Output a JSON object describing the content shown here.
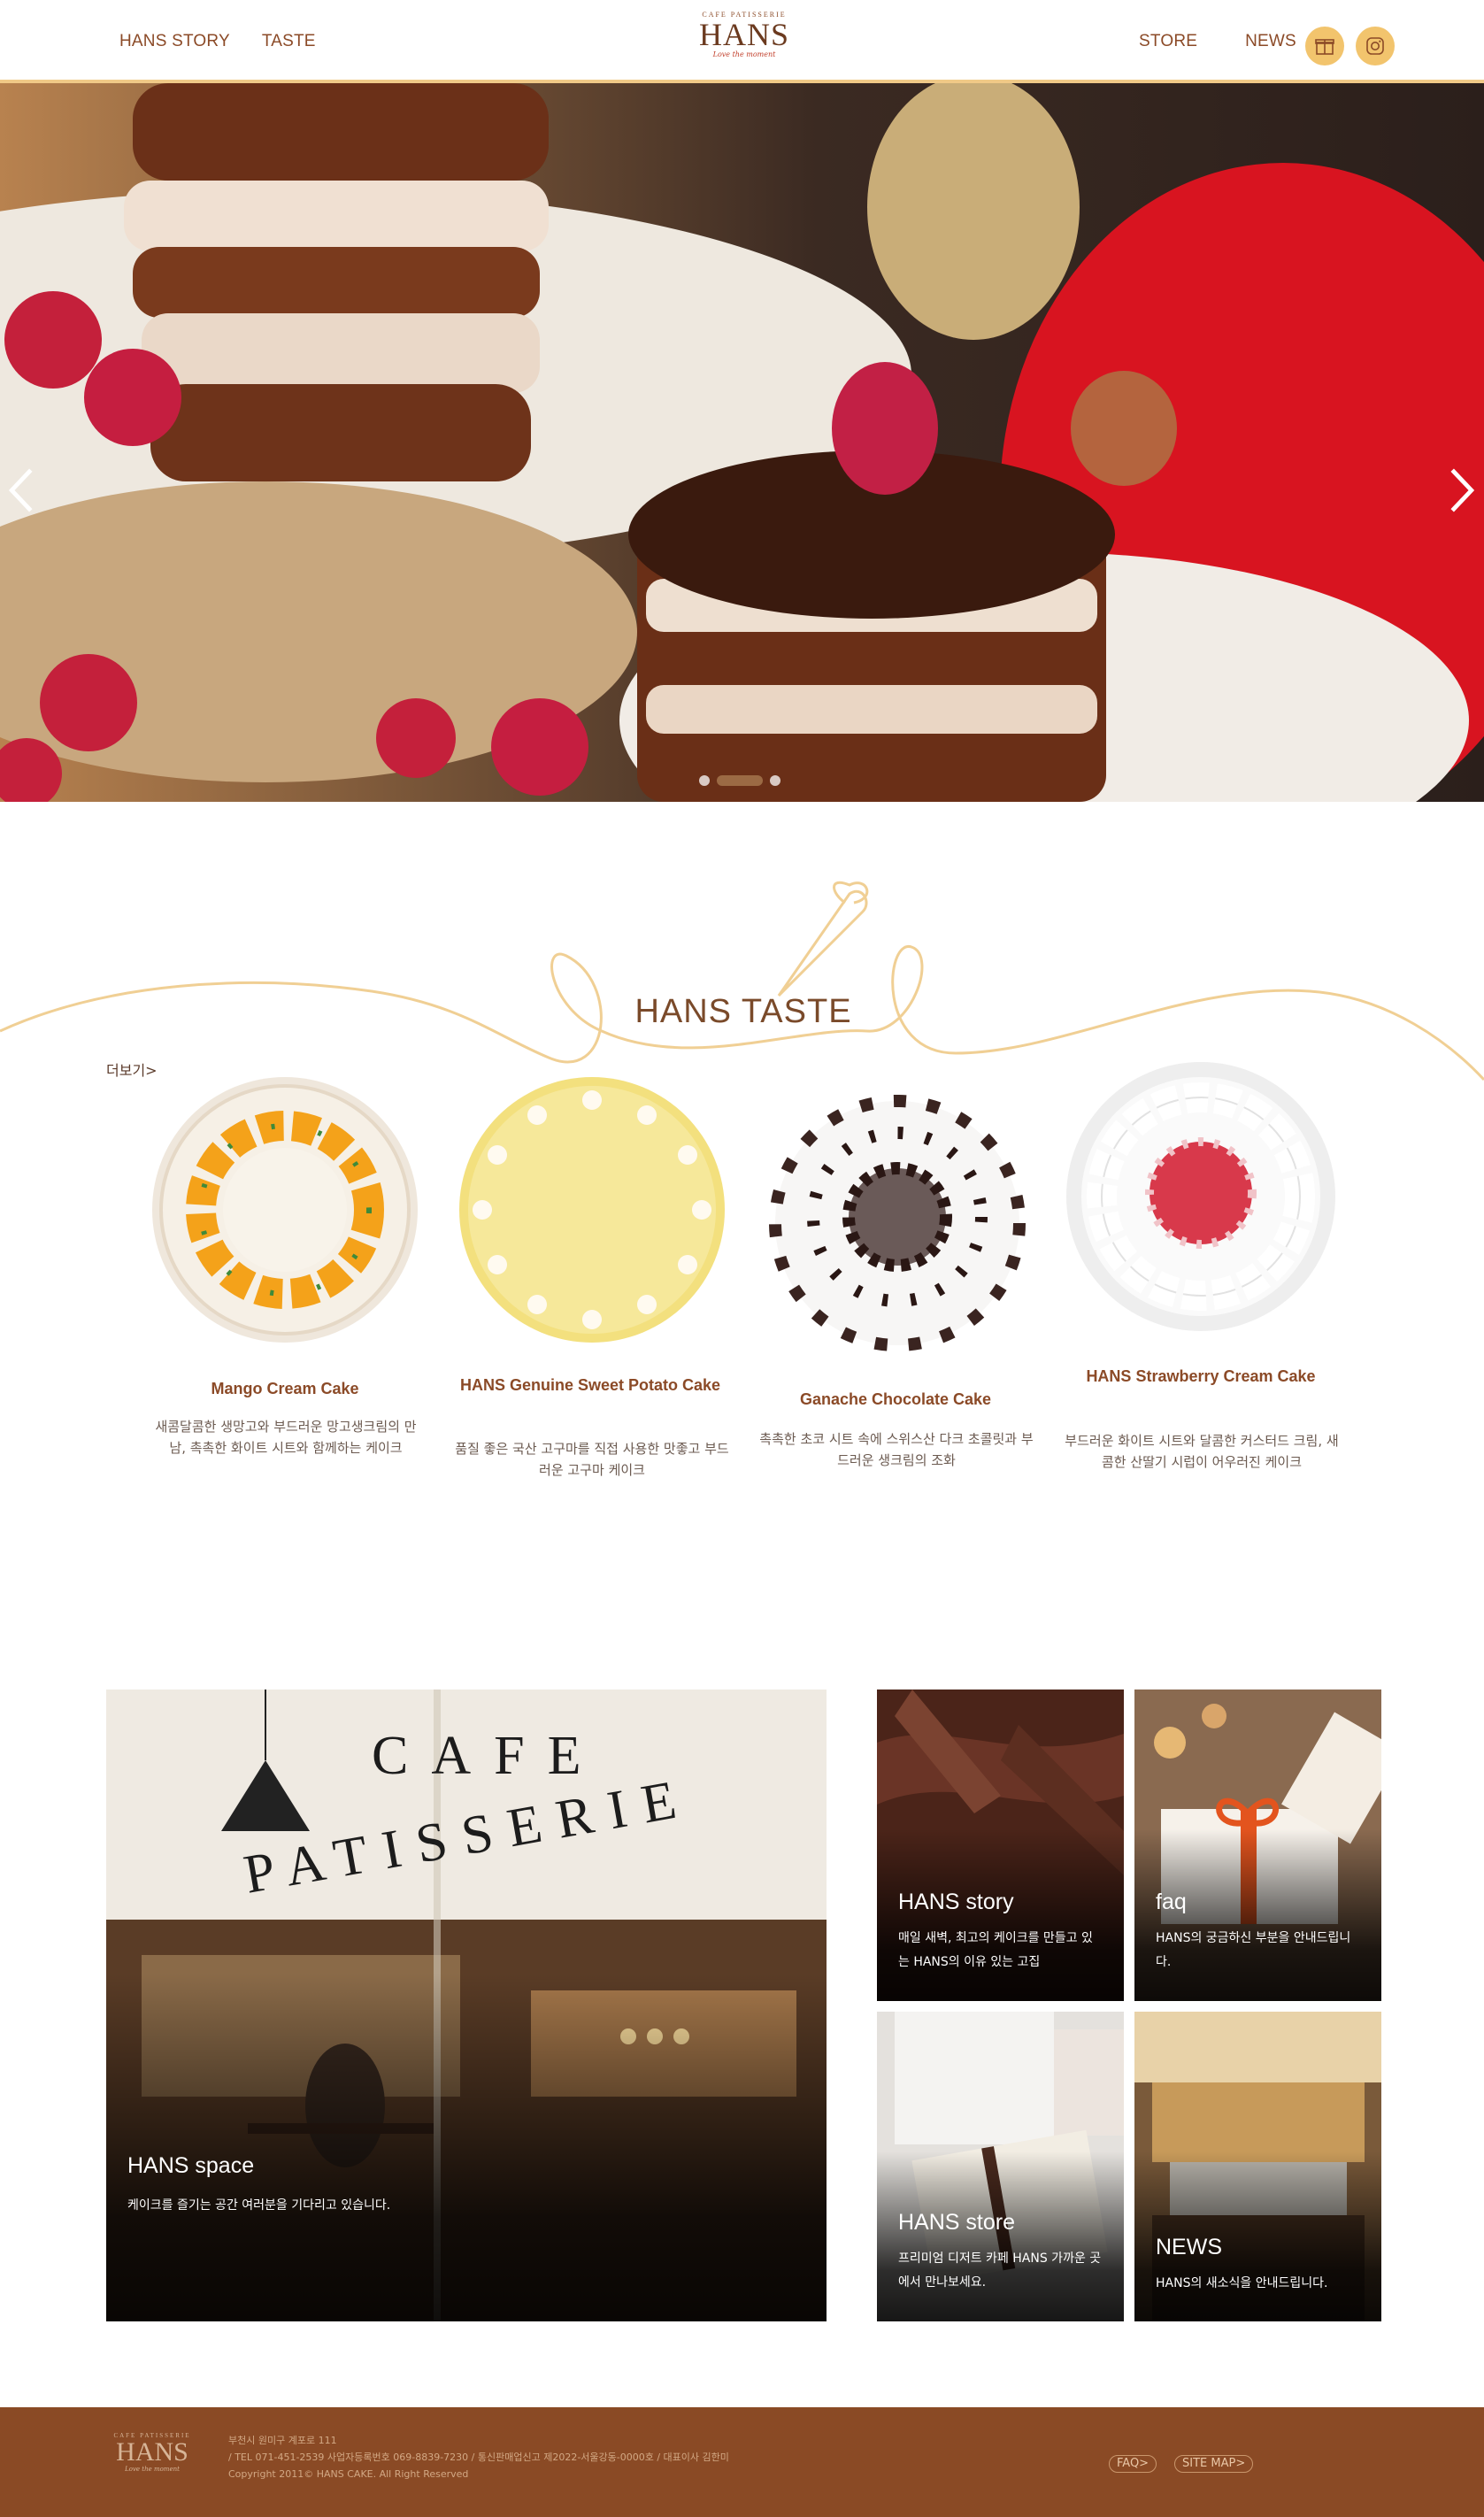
{
  "header": {
    "nav_left": [
      "HANS STORY",
      "TASTE"
    ],
    "nav_right": [
      "STORE",
      "NEWS"
    ],
    "logo": {
      "cafe": "CAFE PATISSERIE",
      "name": "HANS",
      "tagline": "Love the moment"
    },
    "icons": [
      "gift-icon",
      "instagram-icon"
    ]
  },
  "hero": {
    "prev_icon": "chevron-left-icon",
    "next_icon": "chevron-right-icon",
    "slides_count": 3,
    "active_slide": 2
  },
  "taste": {
    "title": "HANS TASTE",
    "more": "더보기>",
    "items": [
      {
        "name": "Mango Cream Cake",
        "desc": "새콤달콤한 생망고와 부드러운 망고생크림의 만남, 촉촉한 화이트 시트와 함께하는 케이크"
      },
      {
        "name": "HANS Genuine Sweet Potato Cake",
        "desc": "품질 좋은 국산 고구마를 직접 사용한 맛좋고 부드러운 고구마 케이크"
      },
      {
        "name": "Ganache Chocolate Cake",
        "desc": "촉촉한 초코 시트 속에 스위스산 다크 초콜릿과 부드러운 생크림의 조화"
      },
      {
        "name": "HANS Strawberry Cream Cake",
        "desc": "부드러운 화이트 시트와 달콤한 커스터드 크림, 새콤한 산딸기 시럽이 어우러진 케이크"
      }
    ]
  },
  "tiles": {
    "space": {
      "title": "HANS space",
      "desc": "케이크를 즐기는 공간 여러분을 기다리고 있습니다.",
      "sign_word1": "CAFE",
      "sign_word2": "PATISSERIE"
    },
    "story": {
      "title": "HANS story",
      "desc": "매일 새벽, 최고의 케이크를 만들고 있는 HANS의 이유 있는 고집"
    },
    "faq": {
      "title": "faq",
      "desc": "HANS의 궁금하신 부분을 안내드립니다."
    },
    "store": {
      "title": "HANS store",
      "desc": "프리미엄 디저트 카페 HANS 가까운 곳에서 만나보세요."
    },
    "news": {
      "title": "NEWS",
      "desc": "HANS의 새소식을 안내드립니다."
    }
  },
  "footer": {
    "logo": {
      "cafe": "CAFE PATISSERIE",
      "name": "HANS",
      "tagline": "Love the moment"
    },
    "address": "부천시 원미구 계포로 111",
    "contact": "/ TEL 071-451-2539 사업자등록번호 069-8839-7230 / 통신판매업신고 제2022-서울강동-0000호 / 대표이사 김한미",
    "copyright": "Copyright 2011© HANS CAKE. All Right Reserved",
    "faq_btn": "FAQ>",
    "sitemap_btn": "SITE MAP>"
  },
  "colors": {
    "brand_brown": "#8b4a27",
    "accent_gold": "#f0c987",
    "footer_bg": "#8a4a25"
  }
}
